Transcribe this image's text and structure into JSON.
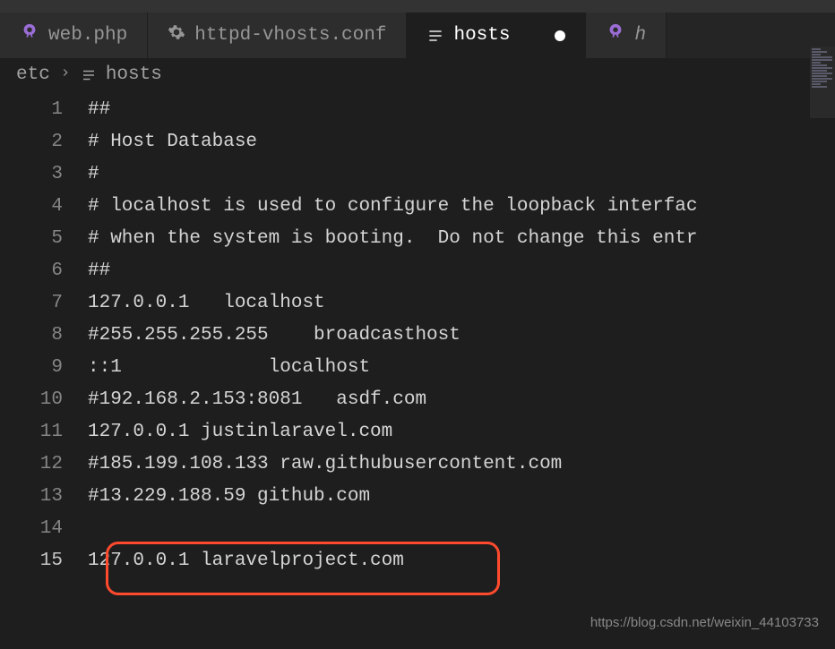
{
  "tabs": [
    {
      "label": "web.php",
      "icon": "php",
      "active": false
    },
    {
      "label": "httpd-vhosts.conf",
      "icon": "gear",
      "active": false
    },
    {
      "label": "hosts",
      "icon": "file",
      "active": true,
      "modified": true
    },
    {
      "label": "h",
      "icon": "php",
      "active": false
    }
  ],
  "breadcrumb": {
    "folder": "etc",
    "file": "hosts"
  },
  "code_lines": [
    "##",
    "# Host Database",
    "#",
    "# localhost is used to configure the loopback interfac",
    "# when the system is booting.  Do not change this entr",
    "##",
    "127.0.0.1   localhost",
    "#255.255.255.255    broadcasthost",
    "::1             localhost",
    "#192.168.2.153:8081   asdf.com",
    "127.0.0.1 justinlaravel.com",
    "#185.199.108.133 raw.githubusercontent.com",
    "#13.229.188.59 github.com",
    "",
    "127.0.0.1 laravelproject.com"
  ],
  "current_line": 15,
  "watermark": "https://blog.csdn.net/weixin_44103733"
}
